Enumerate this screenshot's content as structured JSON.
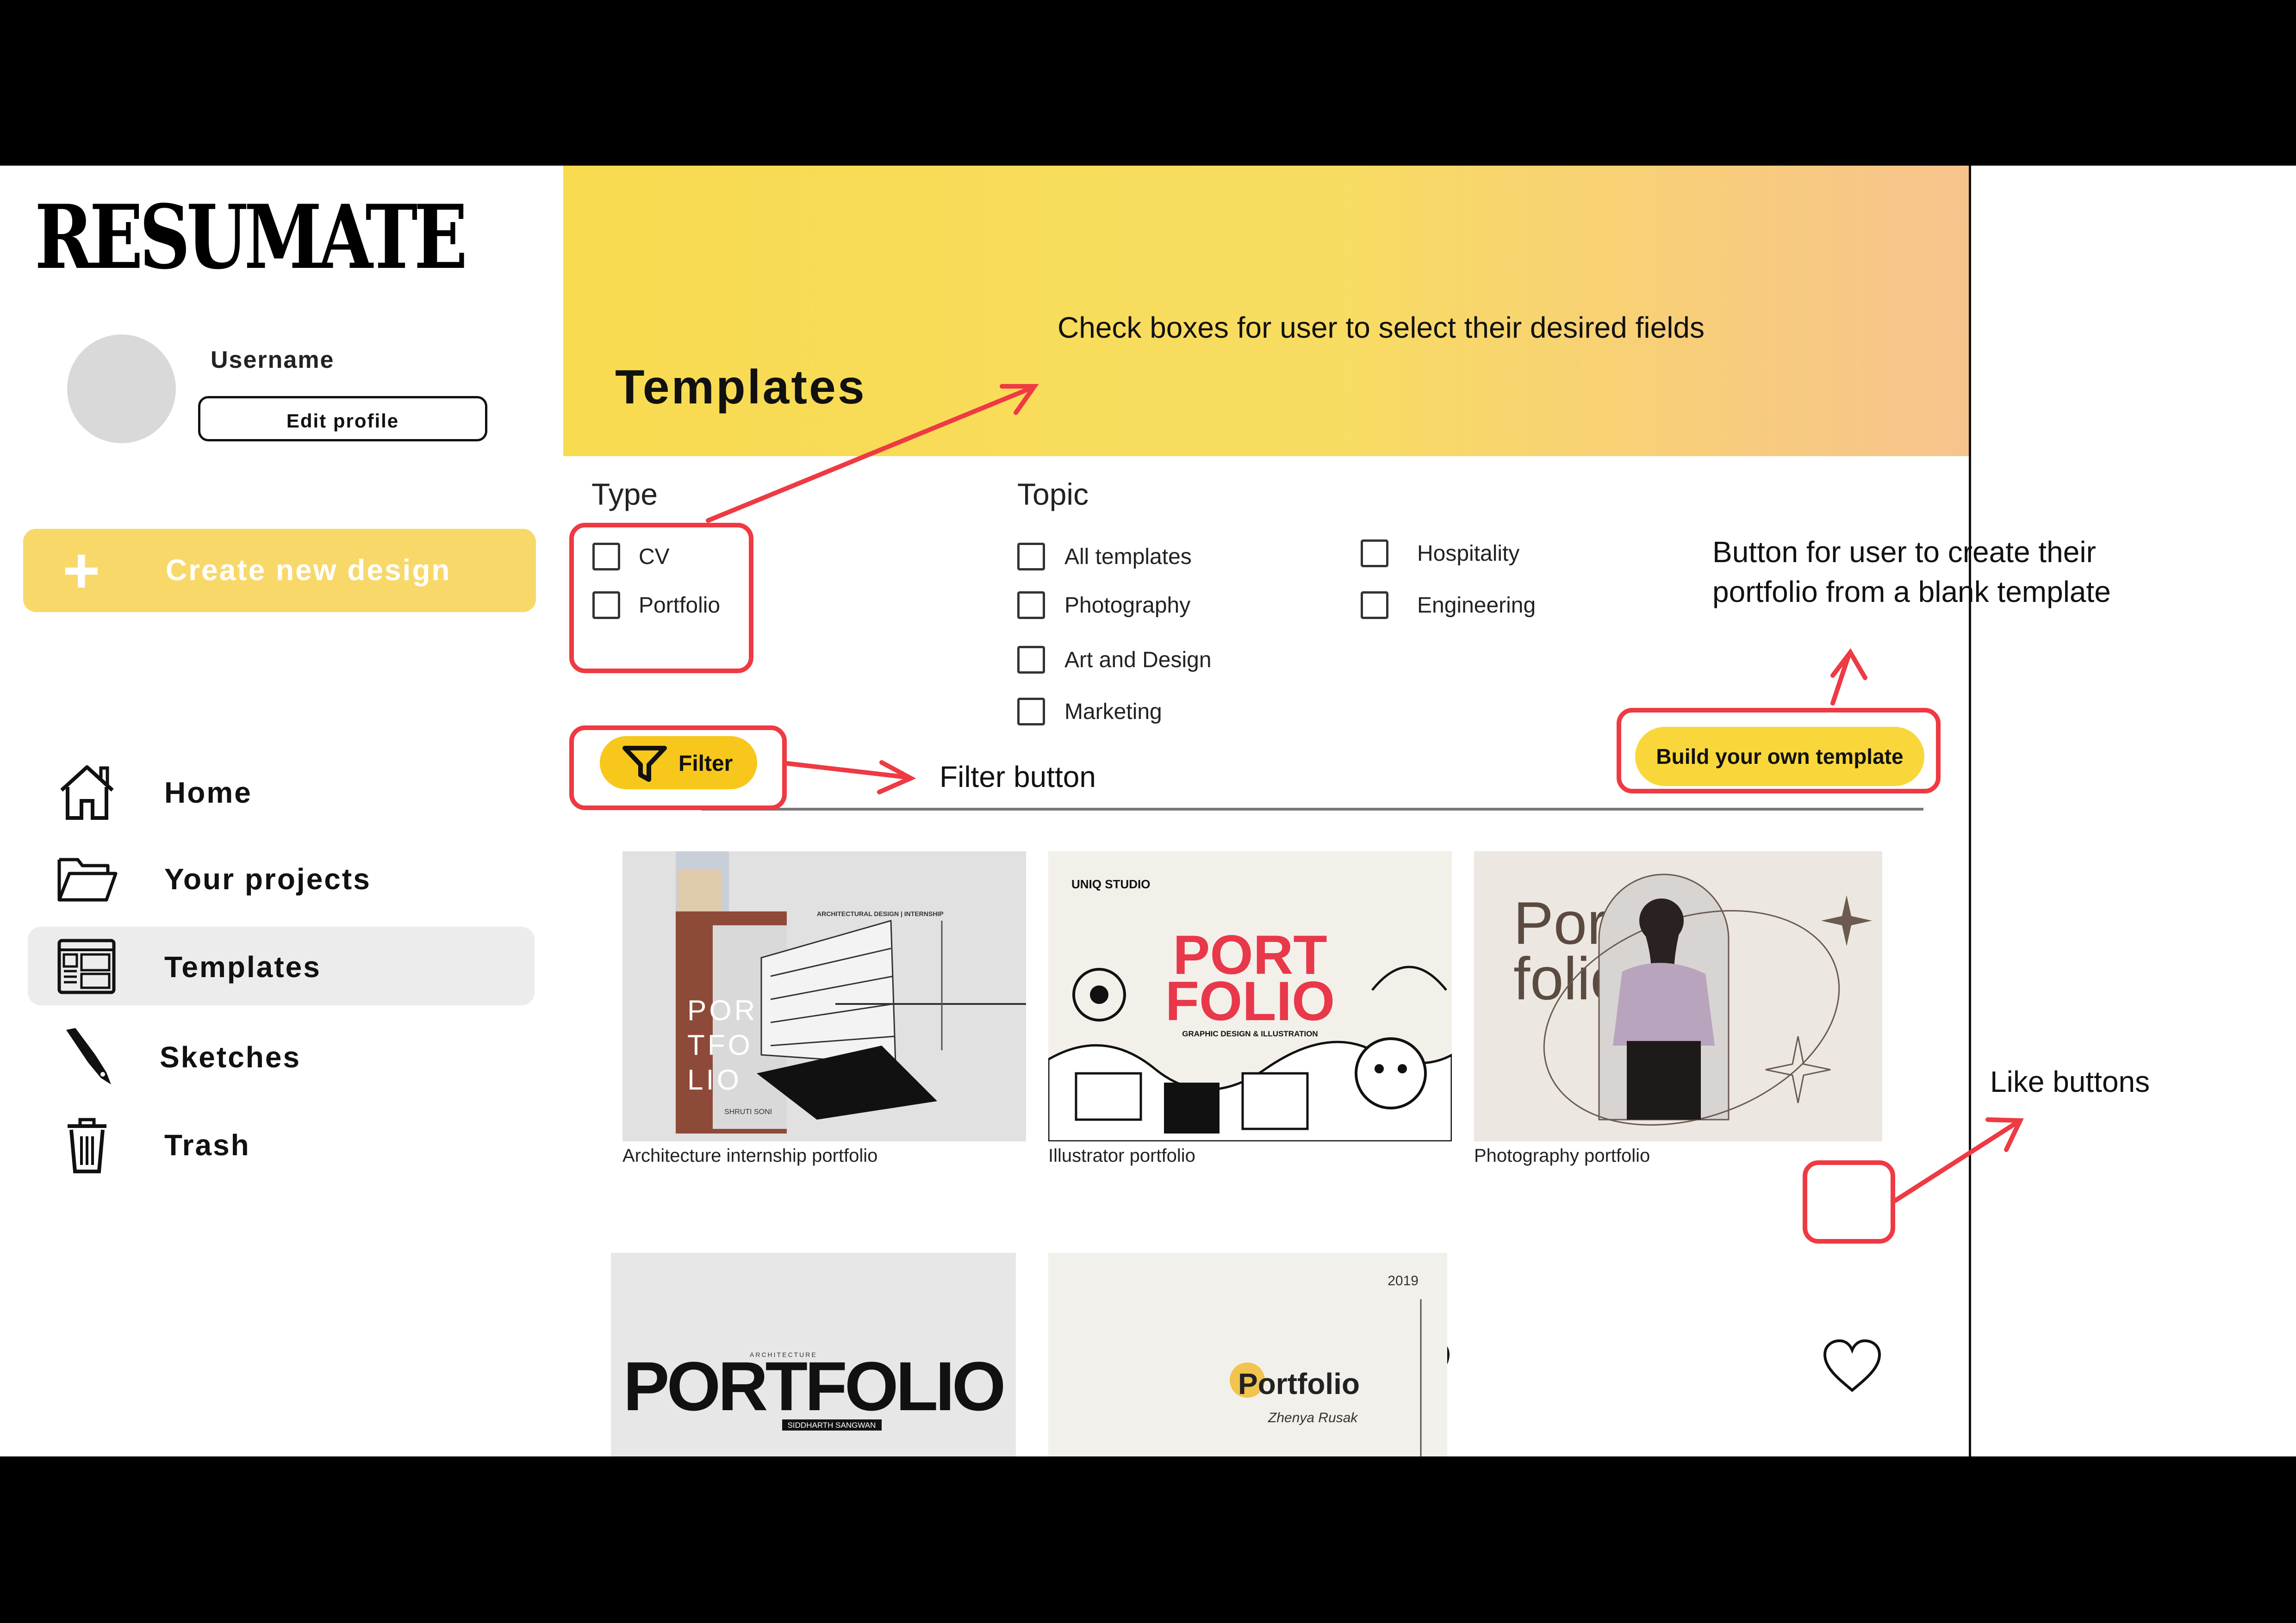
{
  "app": {
    "logo": "RESUMATE",
    "user": {
      "username": "Username",
      "edit_profile": "Edit profile"
    },
    "create_button": "Create new design",
    "nav": [
      {
        "label": "Home",
        "icon": "home-icon"
      },
      {
        "label": "Your projects",
        "icon": "folder-icon"
      },
      {
        "label": "Templates",
        "icon": "templates-icon",
        "active": true
      },
      {
        "label": "Sketches",
        "icon": "pen-nib-icon"
      },
      {
        "label": "Trash",
        "icon": "trash-icon"
      }
    ]
  },
  "header": {
    "title": "Templates",
    "gradient": [
      "#f8db4f",
      "#f7c38d"
    ]
  },
  "filters": {
    "type_title": "Type",
    "type_options": [
      "CV",
      "Portfolio"
    ],
    "topic_title": "Topic",
    "topic_options": [
      "All templates",
      "Photography",
      "Art and Design",
      "Marketing",
      "Hospitality",
      "Engineering"
    ],
    "filter_button": "Filter",
    "build_button": "Build your own template"
  },
  "templates": [
    {
      "caption": "Architecture internship portfolio",
      "art_text": [
        "POR",
        "TFO",
        "LIO"
      ],
      "art_small": "ARCHITECTURAL DESIGN | INTERNSHIP",
      "art_author": "SHRUTI SONI"
    },
    {
      "caption": "Illustrator portfolio",
      "art_text": [
        "PORT",
        "FOLIO"
      ],
      "art_small": "GRAPHIC DESIGN & ILLUSTRATION",
      "art_studio": "UNIQ STUDIO"
    },
    {
      "caption": "Photography portfolio",
      "art_text": [
        "Port",
        "folio"
      ]
    },
    {
      "caption": "",
      "art_text": [
        "PORTFOLIO"
      ],
      "art_small": "ARCHITECTURE",
      "art_author": "SIDDHARTH SANGWAN"
    },
    {
      "caption": "",
      "art_text": [
        "Portfolio"
      ],
      "art_small": "2019",
      "art_author": "Zhenya Rusak"
    }
  ],
  "annotations": {
    "checkboxes": "Check boxes for user to select their desired fields",
    "build": "Button for user to create their portfolio from a blank template",
    "filter": "Filter button",
    "like": "Like buttons"
  },
  "colors": {
    "accent": "#f7c71c",
    "annotation_red": "#ee3a43",
    "create_bg": "#f9d86a"
  }
}
